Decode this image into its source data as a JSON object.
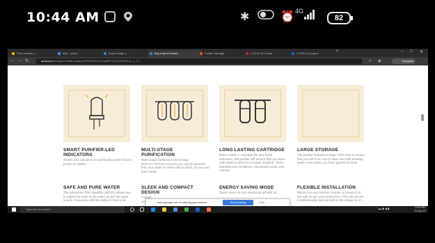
{
  "status_bar": {
    "time": "10:44 AM",
    "battery": "82",
    "network": "4G"
  },
  "browser": {
    "tabs": [
      {
        "label": "Price monitor (...",
        "color": "#f4b400"
      },
      {
        "label": "Mail - which...",
        "color": "#4285f4"
      },
      {
        "label": "Expert finger (...",
        "color": "#2e7dd7"
      },
      {
        "label": "Buy Livpure Enhar...",
        "color": "#2e7dd7"
      },
      {
        "label": "Purifier Manage...",
        "color": "#e65100"
      },
      {
        "label": "COVID-19 Cache",
        "color": "#c62828"
      },
      {
        "label": "COVID-19 project",
        "color": "#1565c0"
      }
    ],
    "url_domain": "amazon.in",
    "url_rest": "/Livpure-Purifier-Amaze-RO-MTDS-UV/dp/B07TC4XJHF/ref=sr_1_2?...",
    "profile_label": "Incognito"
  },
  "features": [
    {
      "title": "SMART PURIFIER-LED INDICATORS",
      "desc": "Smart LED indicators for purification tank full and power on status."
    },
    {
      "title": "MULTI-STAGE PURIFICATION",
      "desc": "Multi-stage purification technology (RO+UV+MTDS) ensures you can be assured that your water is 100% safe to drink, for you and your family."
    },
    {
      "title": "LONG LASTING CARTRIDGE",
      "desc": "With a 3000 L* cartridge life and smart indicators, this purifier will ensure that you have safe water to drink for a longer duration. *Even standard test conditions. Mentioned under user manual."
    },
    {
      "title": "LARGE STORAGE",
      "desc": "The purifier features a large 7 litre tank to ensure that you don't run out of clean and safe drinking water, even when you have guests at home."
    },
    {
      "title": "SAFE AND PURE WATER",
      "desc": "The advanced TDS regulator (MTDS) allows you to adjust the taste of the water as per the water source. Purposes with the ability to treat a lot."
    },
    {
      "title": "SLEEK AND COMPACT DESIGN",
      "desc": "A sleek and compact design..."
    },
    {
      "title": "ENERGY SAVING MODE",
      "desc": "Saves more on your electricity bill with an..."
    },
    {
      "title": "FLEXIBLE INSTALLATION",
      "desc": "Place it on your kitchen counter or mount it on the wall as per your preference. The unit can be installed easily and will add to the elegance of..."
    }
  ],
  "popup": {
    "message": "meet.google.com is sharing your screen.",
    "stop_button": "Stop sharing",
    "hide_link": "Hide"
  },
  "taskbar": {
    "search_placeholder": "Type here to search",
    "clock": "10:44 AM",
    "date": "16-Sep-20"
  }
}
